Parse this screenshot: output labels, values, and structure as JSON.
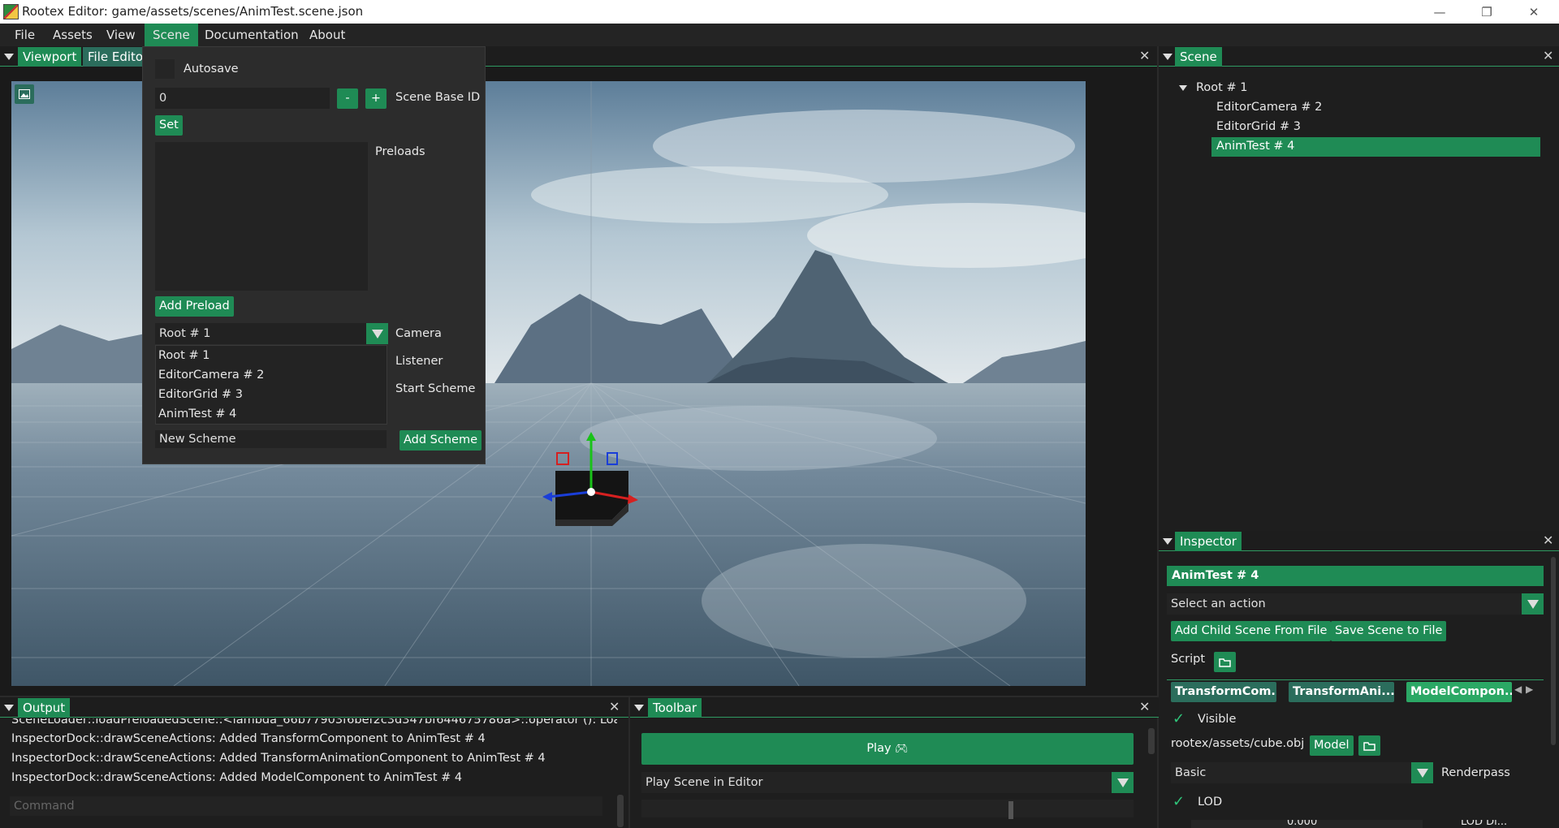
{
  "window": {
    "title": "Rootex Editor: game/assets/scenes/AnimTest.scene.json"
  },
  "menubar": {
    "items": [
      "File",
      "Assets",
      "View",
      "Scene",
      "Documentation",
      "About"
    ],
    "active": "Scene"
  },
  "viewport_panel": {
    "tabs": [
      "Viewport",
      "File Editor"
    ]
  },
  "scene_menu": {
    "autosave_label": "Autosave",
    "base_id_value": "0",
    "minus_label": "-",
    "plus_label": "+",
    "base_id_label": "Scene Base ID",
    "set_label": "Set",
    "preloads_label": "Preloads",
    "add_preload_label": "Add Preload",
    "camera_value": "Root # 1",
    "camera_label": "Camera",
    "listener_label": "Listener",
    "start_scheme_label": "Start Scheme",
    "dropdown_options": [
      "Root # 1",
      "EditorCamera # 2",
      "EditorGrid # 3",
      "AnimTest # 4"
    ],
    "new_scheme_placeholder": "New Scheme",
    "add_scheme_label": "Add Scheme"
  },
  "scene_panel": {
    "tab": "Scene",
    "tree": [
      {
        "label": "Root # 1",
        "level": 0,
        "expanded": true,
        "selected": false
      },
      {
        "label": "EditorCamera # 2",
        "level": 1,
        "selected": false
      },
      {
        "label": "EditorGrid # 3",
        "level": 1,
        "selected": false
      },
      {
        "label": "AnimTest # 4",
        "level": 1,
        "selected": true
      }
    ]
  },
  "inspector": {
    "tab": "Inspector",
    "entity_name": "AnimTest # 4",
    "action_select": "Select an action",
    "add_child_label": "Add Child Scene From File",
    "save_scene_label": "Save Scene to File",
    "script_label": "Script",
    "component_tabs": [
      "TransformCom...",
      "TransformAni...",
      "ModelCompon..."
    ],
    "active_component": "ModelCompon...",
    "visible_label": "Visible",
    "model_path": "rootex/assets/cube.obj",
    "model_button": "Model",
    "renderpass_value": "Basic",
    "renderpass_label": "Renderpass",
    "lod_label": "LOD",
    "lod_value": "0.000",
    "lod_extra_label": "LOD Di..."
  },
  "output_panel": {
    "tab": "Output",
    "lines": [
      "SceneLoader::loadPreloadedScene::<lambda_66b77903f6bef2c3d347bf644675786a>::operator (): Loaded scene",
      "InspectorDock::drawSceneActions: Added TransformComponent to AnimTest # 4",
      "InspectorDock::drawSceneActions: Added TransformAnimationComponent to AnimTest # 4",
      "InspectorDock::drawSceneActions: Added ModelComponent to AnimTest # 4"
    ],
    "command_placeholder": "Command"
  },
  "toolbar_panel": {
    "tab": "Toolbar",
    "play_label": "Play",
    "play_icon": "game-controller-icon",
    "play_mode_value": "Play Scene in Editor"
  },
  "colors": {
    "accent": "#1f8b55",
    "panel_bg": "#1e1e1e",
    "field_bg": "#2a2a2a"
  }
}
